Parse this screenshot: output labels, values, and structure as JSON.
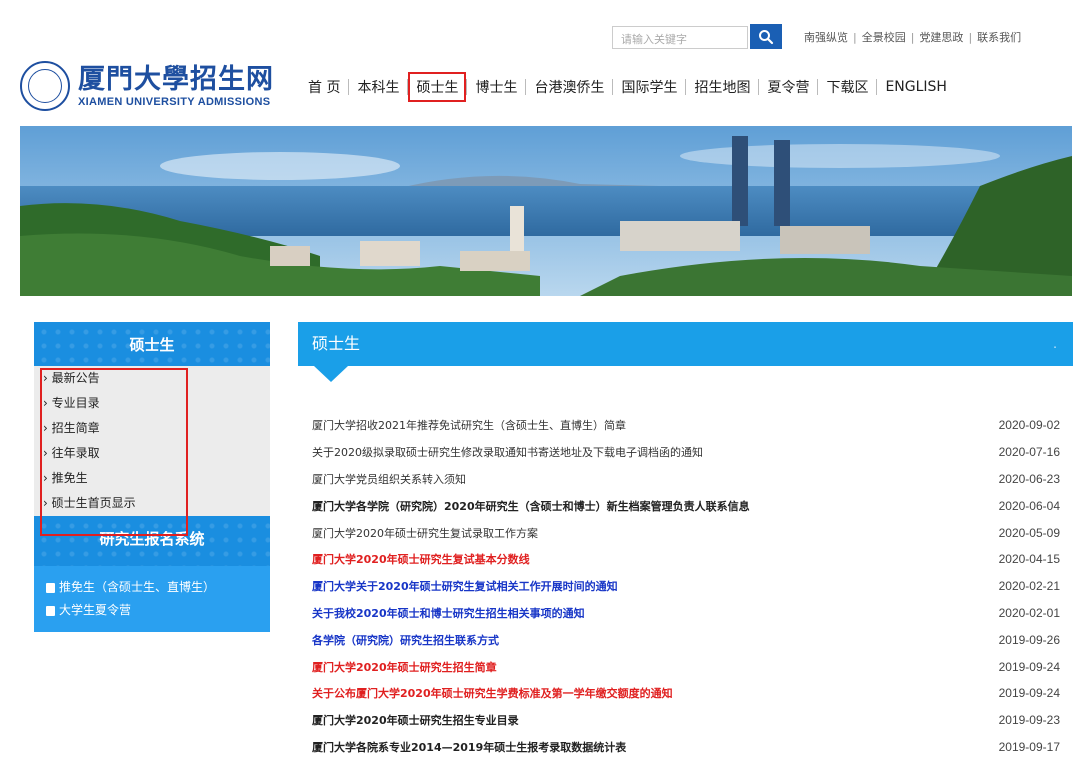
{
  "search": {
    "placeholder": "请输入关键字"
  },
  "quicklinks": [
    "南强纵览",
    "全景校园",
    "党建思政",
    "联系我们"
  ],
  "logo": {
    "cn": "厦門大學招生网",
    "en": "XIAMEN UNIVERSITY ADMISSIONS"
  },
  "nav": [
    "首 页",
    "本科生",
    "硕士生",
    "博士生",
    "台港澳侨生",
    "国际学生",
    "招生地图",
    "夏令营",
    "下载区",
    "ENGLISH"
  ],
  "sidebar": {
    "title": "硕士生",
    "items": [
      "最新公告",
      "专业目录",
      "招生简章",
      "往年录取",
      "推免生",
      "硕士生首页显示"
    ],
    "system_title": "研究生报名系统",
    "system_links": [
      "推免生（含硕士生、直博生）",
      "大学生夏令营"
    ]
  },
  "main": {
    "title": "硕士生",
    "dot": ".",
    "news": [
      {
        "title": "厦门大学招收2021年推荐免试研究生（含硕士生、直博生）简章",
        "date": "2020-09-02",
        "style": "normal"
      },
      {
        "title": "关于2020级拟录取硕士研究生修改录取通知书寄送地址及下载电子调档函的通知",
        "date": "2020-07-16",
        "style": "normal"
      },
      {
        "title": "厦门大学党员组织关系转入须知",
        "date": "2020-06-23",
        "style": "normal"
      },
      {
        "title": "厦门大学各学院（研究院）2020年研究生（含硕士和博士）新生档案管理负责人联系信息",
        "date": "2020-06-04",
        "style": "bold"
      },
      {
        "title": "厦门大学2020年硕士研究生复试录取工作方案",
        "date": "2020-05-09",
        "style": "normal"
      },
      {
        "title": "厦门大学2020年硕士研究生复试基本分数线",
        "date": "2020-04-15",
        "style": "red"
      },
      {
        "title": "厦门大学关于2020年硕士研究生复试相关工作开展时间的通知",
        "date": "2020-02-21",
        "style": "blue"
      },
      {
        "title": "关于我校2020年硕士和博士研究生招生相关事项的通知",
        "date": "2020-02-01",
        "style": "blue"
      },
      {
        "title": "各学院（研究院）研究生招生联系方式",
        "date": "2019-09-26",
        "style": "blue"
      },
      {
        "title": "厦门大学2020年硕士研究生招生简章",
        "date": "2019-09-24",
        "style": "red"
      },
      {
        "title": "关于公布厦门大学2020年硕士研究生学费标准及第一学年缴交额度的通知",
        "date": "2019-09-24",
        "style": "red"
      },
      {
        "title": "厦门大学2020年硕士研究生招生专业目录",
        "date": "2019-09-23",
        "style": "bold"
      },
      {
        "title": "厦门大学各院系专业2014—2019年硕士生报考录取数据统计表",
        "date": "2019-09-17",
        "style": "bold"
      }
    ]
  },
  "colors": {
    "accent": "#1a9fe8",
    "highlight": "#e02020",
    "link_blue": "#1836c7"
  },
  "icons": [
    "search-icon",
    "book-icon"
  ]
}
